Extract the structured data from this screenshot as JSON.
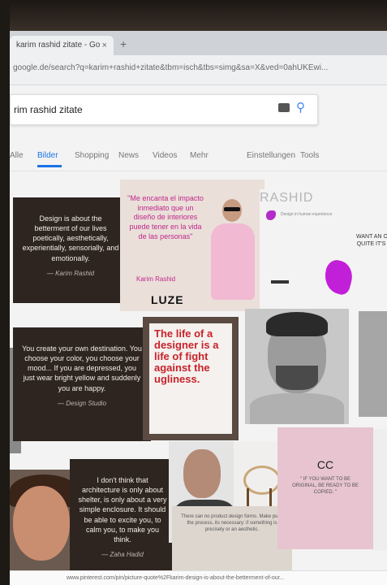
{
  "browser": {
    "tab_title": "karim rashid zitate - Go",
    "tab_close": "×",
    "new_tab": "+",
    "url": "google.de/search?q=karim+rashid+zitate&tbm=isch&tbs=simg&sa=X&ved=0ahUKEwi..."
  },
  "search": {
    "query": "rim rashid zitate"
  },
  "nav": {
    "items": [
      "Alle",
      "Bilder",
      "Shopping",
      "News",
      "Videos",
      "Mehr",
      "Einstellungen",
      "Tools"
    ],
    "active": "Bilder"
  },
  "results": {
    "quote1": {
      "text": "Design is about the betterment of our lives poetically, aesthetically, experientially, sensorially, and emotionally.",
      "sig": "— Karim Rashid"
    },
    "luze": {
      "quote": "\"Me encanta el impacto inmediato que un diseño de interiores puede tener en la vida de las personas\"",
      "name": "Karim Rashid",
      "logo": "LUZE"
    },
    "rashid": {
      "title": "RASHID",
      "sub": "Design in human experience"
    },
    "right1": {
      "text": "WANT AN OH QUITE IT'S H"
    },
    "quote2": {
      "text": "You create your own destination. You choose your color, you choose your mood... If you are depressed, you just wear bright yellow and suddenly you are happy.",
      "sig": "— Design Studio"
    },
    "red": {
      "text": "The life of a designer is a life of fight against the ugliness."
    },
    "quote3": {
      "text": "I don't think that architecture is only about shelter, is only about a very simple enclosure. It should be able to excite you, to calm you, to make you think.",
      "sig": "— Zaha Hadid"
    },
    "grey_quote": {
      "text": "There can no product design forms. Make push the process, its necessary: if something is precisely or an aesthetic."
    },
    "chanel": {
      "logo": "CC",
      "quote": "\" IF YOU WANT TO BE ORIGINAL, BE READY TO BE COPIED. \""
    }
  },
  "status": {
    "url": "www.pinterest.com/pin/picture-quote%2Fkarim-design-is-about-the-betterment-of-our..."
  }
}
